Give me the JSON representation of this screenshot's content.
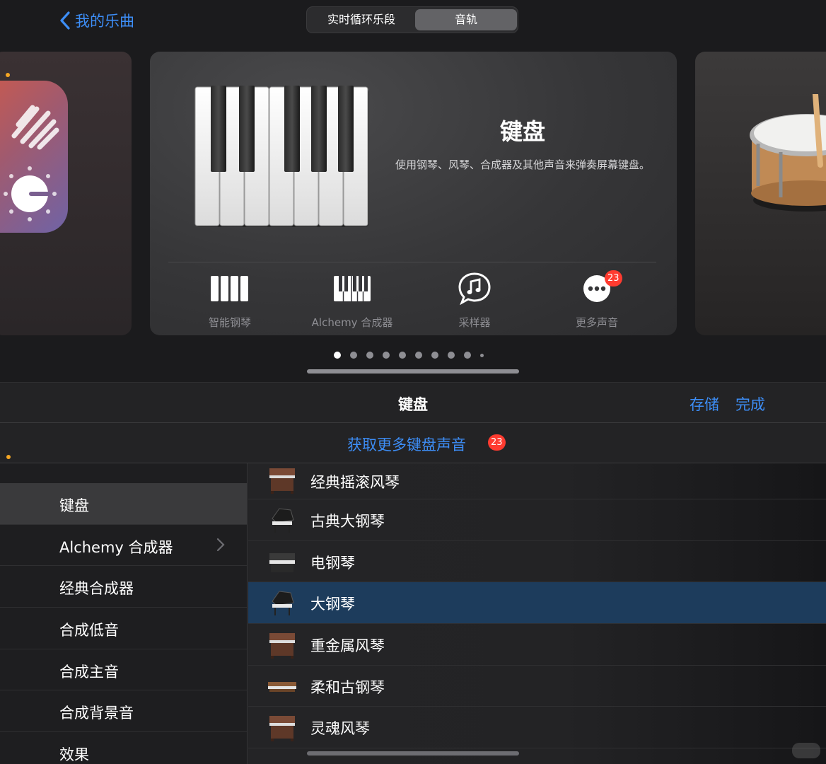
{
  "topbar": {
    "back_label": "我的乐曲",
    "segments": [
      "实时循环乐段",
      "音轨"
    ],
    "selected_segment": "音轨"
  },
  "card": {
    "title": "键盘",
    "description": "使用钢琴、风琴、合成器及其他声音来弹奏屏幕键盘。",
    "instruments": [
      {
        "label": "智能钢琴",
        "icon": "smart-piano-icon"
      },
      {
        "label": "Alchemy 合成器",
        "icon": "synth-keys-icon"
      },
      {
        "label": "采样器",
        "icon": "sampler-note-icon"
      },
      {
        "label": "更多声音",
        "icon": "more-ellipsis-icon",
        "badge": "23"
      }
    ]
  },
  "pager": {
    "count": 10,
    "active": 0
  },
  "panel": {
    "title": "键盘",
    "save_label": "存储",
    "done_label": "完成",
    "more_sounds_label": "获取更多键盘声音",
    "more_sounds_badge": "23"
  },
  "categories": [
    {
      "label": "键盘",
      "selected": true
    },
    {
      "label": "Alchemy 合成器",
      "chevron": true
    },
    {
      "label": "经典合成器"
    },
    {
      "label": "合成低音"
    },
    {
      "label": "合成主音"
    },
    {
      "label": "合成背景音"
    },
    {
      "label": "效果"
    }
  ],
  "sounds": [
    {
      "label": "经典摇滚风琴",
      "icon": "organ-icon"
    },
    {
      "label": "古典大钢琴",
      "icon": "grand-piano-icon"
    },
    {
      "label": "电钢琴",
      "icon": "electric-piano-icon"
    },
    {
      "label": "大钢琴",
      "icon": "grand-piano-icon",
      "selected": true
    },
    {
      "label": "重金属风琴",
      "icon": "organ-icon"
    },
    {
      "label": "柔和古钢琴",
      "icon": "clavinet-icon"
    },
    {
      "label": "灵魂风琴",
      "icon": "organ-icon"
    }
  ],
  "colors": {
    "accent": "#3d8ef7",
    "badge": "#ff3b30",
    "selected_row": "#1d3c5c"
  }
}
